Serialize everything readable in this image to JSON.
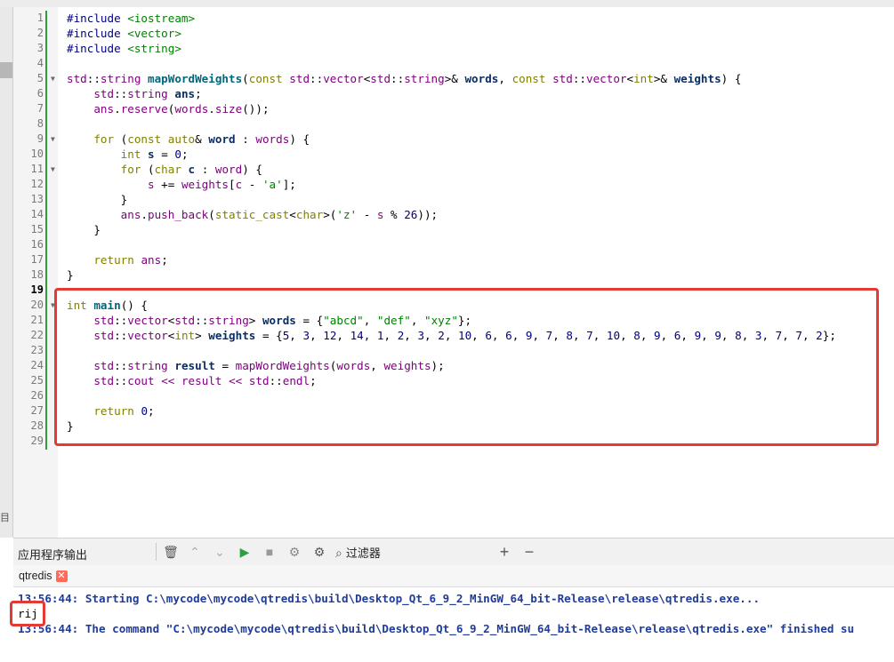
{
  "editor": {
    "current_line": 19,
    "lines": [
      {
        "n": 1,
        "segs": [
          [
            "pp",
            "#include "
          ],
          [
            "inc",
            "<iostream>"
          ]
        ]
      },
      {
        "n": 2,
        "segs": [
          [
            "pp",
            "#include "
          ],
          [
            "inc",
            "<vector>"
          ]
        ]
      },
      {
        "n": 3,
        "segs": [
          [
            "pp",
            "#include "
          ],
          [
            "inc",
            "<string>"
          ]
        ]
      },
      {
        "n": 4,
        "segs": []
      },
      {
        "n": 5,
        "fold": true,
        "segs": [
          [
            "typ",
            "std"
          ],
          [
            "",
            "::"
          ],
          [
            "typ",
            "string"
          ],
          [
            "",
            " "
          ],
          [
            "fn",
            "mapWordWeights"
          ],
          [
            "",
            "("
          ],
          [
            "kw",
            "const"
          ],
          [
            "",
            " "
          ],
          [
            "typ",
            "std"
          ],
          [
            "",
            "::"
          ],
          [
            "typ",
            "vector"
          ],
          [
            "",
            "<"
          ],
          [
            "typ",
            "std"
          ],
          [
            "",
            "::"
          ],
          [
            "typ",
            "string"
          ],
          [
            "",
            "&gt;& "
          ],
          [
            "var",
            "words"
          ],
          [
            "",
            ", "
          ],
          [
            "kw",
            "const"
          ],
          [
            "",
            " "
          ],
          [
            "typ",
            "std"
          ],
          [
            "",
            "::"
          ],
          [
            "typ",
            "vector"
          ],
          [
            "",
            "<"
          ],
          [
            "kw",
            "int"
          ],
          [
            "",
            "&gt;& "
          ],
          [
            "var",
            "weights"
          ],
          [
            "",
            ") {"
          ]
        ]
      },
      {
        "n": 6,
        "segs": [
          [
            "",
            "    "
          ],
          [
            "typ",
            "std"
          ],
          [
            "",
            "::"
          ],
          [
            "typ",
            "string"
          ],
          [
            "",
            " "
          ],
          [
            "var",
            "ans"
          ],
          [
            "",
            ";"
          ]
        ]
      },
      {
        "n": 7,
        "segs": [
          [
            "",
            "    "
          ],
          [
            "typ",
            "ans"
          ],
          [
            "",
            "."
          ],
          [
            "typ",
            "reserve"
          ],
          [
            "",
            "("
          ],
          [
            "typ",
            "words"
          ],
          [
            "",
            "."
          ],
          [
            "typ",
            "size"
          ],
          [
            "",
            "());"
          ]
        ]
      },
      {
        "n": 8,
        "segs": []
      },
      {
        "n": 9,
        "fold": true,
        "segs": [
          [
            "",
            "    "
          ],
          [
            "kw",
            "for"
          ],
          [
            "",
            " ("
          ],
          [
            "kw",
            "const"
          ],
          [
            "",
            " "
          ],
          [
            "kw",
            "auto"
          ],
          [
            "",
            "& "
          ],
          [
            "var",
            "word"
          ],
          [
            "",
            " : "
          ],
          [
            "typ",
            "words"
          ],
          [
            "",
            ") {"
          ]
        ]
      },
      {
        "n": 10,
        "segs": [
          [
            "",
            "        "
          ],
          [
            "kw",
            "int"
          ],
          [
            "",
            " "
          ],
          [
            "var",
            "s"
          ],
          [
            "",
            " = "
          ],
          [
            "num",
            "0"
          ],
          [
            "",
            ";"
          ]
        ]
      },
      {
        "n": 11,
        "fold": true,
        "segs": [
          [
            "",
            "        "
          ],
          [
            "kw",
            "for"
          ],
          [
            "",
            " ("
          ],
          [
            "kw",
            "char"
          ],
          [
            "",
            " "
          ],
          [
            "var",
            "c"
          ],
          [
            "",
            " : "
          ],
          [
            "typ",
            "word"
          ],
          [
            "",
            ") {"
          ]
        ]
      },
      {
        "n": 12,
        "segs": [
          [
            "",
            "            "
          ],
          [
            "typ",
            "s"
          ],
          [
            "",
            " += "
          ],
          [
            "typ",
            "weights"
          ],
          [
            "",
            "["
          ],
          [
            "typ",
            "c"
          ],
          [
            "",
            " - "
          ],
          [
            "str",
            "'a'"
          ],
          [
            "",
            "];"
          ]
        ]
      },
      {
        "n": 13,
        "segs": [
          [
            "",
            "        }"
          ]
        ]
      },
      {
        "n": 14,
        "segs": [
          [
            "",
            "        "
          ],
          [
            "typ",
            "ans"
          ],
          [
            "",
            "."
          ],
          [
            "typ",
            "push_back"
          ],
          [
            "",
            "("
          ],
          [
            "kw",
            "static_cast"
          ],
          [
            "",
            "<"
          ],
          [
            "kw",
            "char"
          ],
          [
            "",
            "&gt;("
          ],
          [
            "str",
            "'z'"
          ],
          [
            "",
            " - "
          ],
          [
            "typ",
            "s"
          ],
          [
            "",
            " % "
          ],
          [
            "num",
            "26"
          ],
          [
            "",
            "));"
          ]
        ]
      },
      {
        "n": 15,
        "segs": [
          [
            "",
            "    }"
          ]
        ]
      },
      {
        "n": 16,
        "segs": []
      },
      {
        "n": 17,
        "segs": [
          [
            "",
            "    "
          ],
          [
            "kw",
            "return"
          ],
          [
            "",
            " "
          ],
          [
            "typ",
            "ans"
          ],
          [
            "",
            ";"
          ]
        ]
      },
      {
        "n": 18,
        "segs": [
          [
            "",
            "}"
          ]
        ]
      },
      {
        "n": 19,
        "segs": []
      },
      {
        "n": 20,
        "fold": true,
        "segs": [
          [
            "kw",
            "int"
          ],
          [
            "",
            " "
          ],
          [
            "fn",
            "main"
          ],
          [
            "",
            "() {"
          ]
        ]
      },
      {
        "n": 21,
        "segs": [
          [
            "",
            "    "
          ],
          [
            "typ",
            "std"
          ],
          [
            "",
            "::"
          ],
          [
            "typ",
            "vector"
          ],
          [
            "",
            "<"
          ],
          [
            "typ",
            "std"
          ],
          [
            "",
            "::"
          ],
          [
            "typ",
            "string"
          ],
          [
            "",
            "&gt; "
          ],
          [
            "var",
            "words"
          ],
          [
            "",
            " = {"
          ],
          [
            "str",
            "\"abcd\""
          ],
          [
            "",
            ", "
          ],
          [
            "str",
            "\"def\""
          ],
          [
            "",
            ", "
          ],
          [
            "str",
            "\"xyz\""
          ],
          [
            "",
            "};"
          ]
        ]
      },
      {
        "n": 22,
        "segs": [
          [
            "",
            "    "
          ],
          [
            "typ",
            "std"
          ],
          [
            "",
            "::"
          ],
          [
            "typ",
            "vector"
          ],
          [
            "",
            "<"
          ],
          [
            "kw",
            "int"
          ],
          [
            "",
            "&gt; "
          ],
          [
            "var",
            "weights"
          ],
          [
            "",
            " = {"
          ],
          [
            "num",
            "5"
          ],
          [
            "",
            ", "
          ],
          [
            "num",
            "3"
          ],
          [
            "",
            ", "
          ],
          [
            "num",
            "12"
          ],
          [
            "",
            ", "
          ],
          [
            "num",
            "14"
          ],
          [
            "",
            ", "
          ],
          [
            "num",
            "1"
          ],
          [
            "",
            ", "
          ],
          [
            "num",
            "2"
          ],
          [
            "",
            ", "
          ],
          [
            "num",
            "3"
          ],
          [
            "",
            ", "
          ],
          [
            "num",
            "2"
          ],
          [
            "",
            ", "
          ],
          [
            "num",
            "10"
          ],
          [
            "",
            ", "
          ],
          [
            "num",
            "6"
          ],
          [
            "",
            ", "
          ],
          [
            "num",
            "6"
          ],
          [
            "",
            ", "
          ],
          [
            "num",
            "9"
          ],
          [
            "",
            ", "
          ],
          [
            "num",
            "7"
          ],
          [
            "",
            ", "
          ],
          [
            "num",
            "8"
          ],
          [
            "",
            ", "
          ],
          [
            "num",
            "7"
          ],
          [
            "",
            ", "
          ],
          [
            "num",
            "10"
          ],
          [
            "",
            ", "
          ],
          [
            "num",
            "8"
          ],
          [
            "",
            ", "
          ],
          [
            "num",
            "9"
          ],
          [
            "",
            ", "
          ],
          [
            "num",
            "6"
          ],
          [
            "",
            ", "
          ],
          [
            "num",
            "9"
          ],
          [
            "",
            ", "
          ],
          [
            "num",
            "9"
          ],
          [
            "",
            ", "
          ],
          [
            "num",
            "8"
          ],
          [
            "",
            ", "
          ],
          [
            "num",
            "3"
          ],
          [
            "",
            ", "
          ],
          [
            "num",
            "7"
          ],
          [
            "",
            ", "
          ],
          [
            "num",
            "7"
          ],
          [
            "",
            ", "
          ],
          [
            "num",
            "2"
          ],
          [
            "",
            "};"
          ]
        ]
      },
      {
        "n": 23,
        "segs": []
      },
      {
        "n": 24,
        "segs": [
          [
            "",
            "    "
          ],
          [
            "typ",
            "std"
          ],
          [
            "",
            "::"
          ],
          [
            "typ",
            "string"
          ],
          [
            "",
            " "
          ],
          [
            "var",
            "result"
          ],
          [
            "",
            " = "
          ],
          [
            "typ",
            "mapWordWeights"
          ],
          [
            "",
            "("
          ],
          [
            "typ",
            "words"
          ],
          [
            "",
            ", "
          ],
          [
            "typ",
            "weights"
          ],
          [
            "",
            ");"
          ]
        ]
      },
      {
        "n": 25,
        "segs": [
          [
            "",
            "    "
          ],
          [
            "typ",
            "std"
          ],
          [
            "",
            "::"
          ],
          [
            "typ",
            "cout"
          ],
          [
            "",
            " "
          ],
          [
            "typ",
            "<<"
          ],
          [
            "",
            " "
          ],
          [
            "typ",
            "result"
          ],
          [
            "",
            " "
          ],
          [
            "typ",
            "<<"
          ],
          [
            "",
            " "
          ],
          [
            "typ",
            "std"
          ],
          [
            "",
            "::"
          ],
          [
            "typ",
            "endl"
          ],
          [
            "",
            ";"
          ]
        ]
      },
      {
        "n": 26,
        "segs": []
      },
      {
        "n": 27,
        "segs": [
          [
            "",
            "    "
          ],
          [
            "kw",
            "return"
          ],
          [
            "",
            " "
          ],
          [
            "num",
            "0"
          ],
          [
            "",
            ";"
          ]
        ]
      },
      {
        "n": 28,
        "segs": [
          [
            "",
            "}"
          ]
        ]
      },
      {
        "n": 29,
        "segs": []
      }
    ]
  },
  "output_pane": {
    "title": "应用程序输出",
    "filter_label": "过滤器",
    "tab_label": "qtredis",
    "tab_close": "✕",
    "icons": {
      "clear": "🗑",
      "up": "⌃",
      "down": "⌄",
      "run": "▶",
      "stop": "■",
      "attach": "⚙",
      "settings": "⚙",
      "add": "+",
      "remove": "−"
    },
    "lines": [
      {
        "text": "13:56:44: Starting C:\\mycode\\mycode\\qtredis\\build\\Desktop_Qt_6_9_2_MinGW_64_bit-Release\\release\\qtredis.exe...",
        "style": "blue"
      },
      {
        "text": "rij",
        "style": "black"
      },
      {
        "text": "13:56:44: The command \"C:\\mycode\\mycode\\qtredis\\build\\Desktop_Qt_6_9_2_MinGW_64_bit-Release\\release\\qtredis.exe\" finished su",
        "style": "blue"
      }
    ]
  },
  "colors": {
    "highlight_box": "#e53935",
    "modified_bar": "#2f9d3c",
    "output_info": "#1f3c9a"
  }
}
